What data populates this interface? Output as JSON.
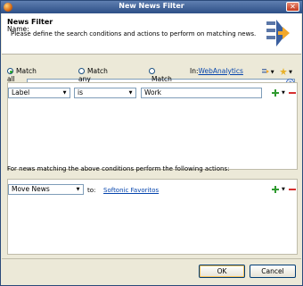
{
  "window": {
    "title": "New News Filter"
  },
  "header": {
    "title": "News Filter",
    "description": "Please define the search conditions and actions to perform on matching news."
  },
  "name_field": {
    "label": "Name:",
    "value": ""
  },
  "match_options": {
    "items": [
      {
        "label": "Match all conditions",
        "selected": true
      },
      {
        "label": "Match any condition",
        "selected": false
      },
      {
        "label": "Match all",
        "selected": false
      }
    ],
    "in_label": "In:",
    "in_link": "WebAnalytics"
  },
  "condition": {
    "field": "Label",
    "operator": "is",
    "value": "Work"
  },
  "actions_section": {
    "label": "For news matching the above conditions perform the following actions:"
  },
  "action": {
    "type": "Move News",
    "to_label": "to:",
    "target": "Softonic Favoritos"
  },
  "buttons": {
    "ok": "OK",
    "cancel": "Cancel"
  },
  "colors": {
    "accent_green": "#2f9a2f",
    "remove_red": "#d63030",
    "link_blue": "#0645ad"
  }
}
